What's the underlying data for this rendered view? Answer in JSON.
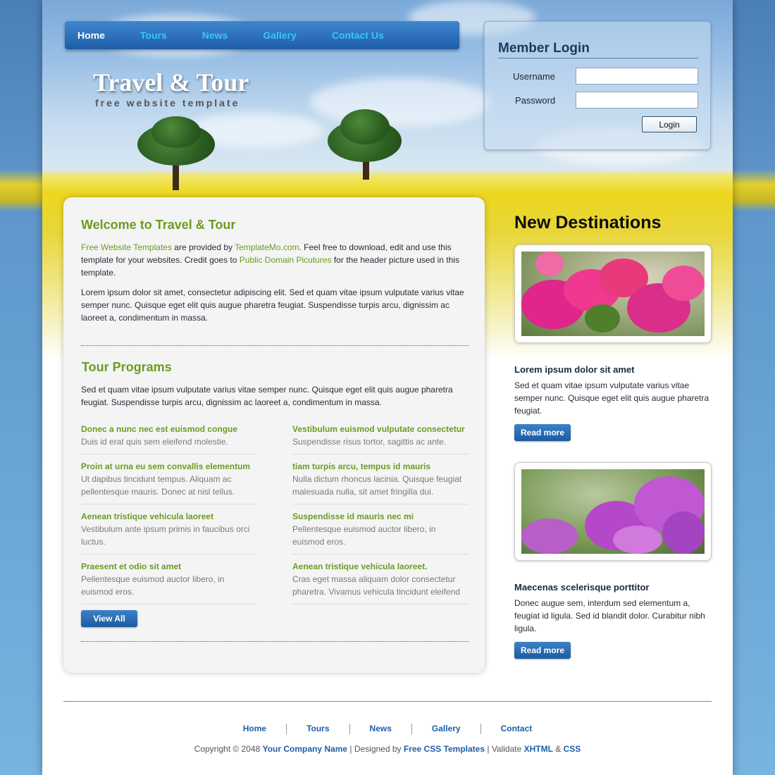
{
  "nav": {
    "items": [
      "Home",
      "Tours",
      "News",
      "Gallery",
      "Contact Us"
    ],
    "active": "Home"
  },
  "header": {
    "title": "Travel & Tour",
    "tagline": "free website template"
  },
  "login": {
    "title": "Member Login",
    "username_label": "Username",
    "password_label": "Password",
    "username_value": "",
    "password_value": "",
    "button": "Login"
  },
  "welcome": {
    "title": "Welcome to Travel & Tour",
    "p1_link1": "Free Website Templates",
    "p1_t1": " are provided by ",
    "p1_link2": "TemplateMo.com",
    "p1_t2": ". Feel free to download, edit and use this template for your websites. Credit goes to ",
    "p1_link3": "Public Domain Picutures",
    "p1_t3": " for the header picture used in this template.",
    "p2": "Lorem ipsum dolor sit amet, consectetur adipiscing elit. Sed et quam vitae ipsum vulputate varius vitae semper nunc. Quisque eget elit quis augue pharetra feugiat. Suspendisse turpis arcu, dignissim ac laoreet a, condimentum in massa."
  },
  "programs": {
    "title": "Tour Programs",
    "intro": "Sed et quam vitae ipsum vulputate varius vitae semper nunc. Quisque eget elit quis augue pharetra feugiat. Suspendisse turpis arcu, dignissim ac laoreet a, condimentum in massa.",
    "items": [
      {
        "title": "Donec a nunc nec est euismod congue",
        "desc": "Duis id erat quis sem eleifend molestie."
      },
      {
        "title": "Vestibulum euismod vulputate consectetur",
        "desc": "Suspendisse risus tortor, sagittis ac ante."
      },
      {
        "title": "Proin at urna eu sem convallis elementum",
        "desc": "Ut dapibus tincidunt tempus. Aliquam ac pellentesque mauris. Donec at nisl tellus."
      },
      {
        "title": "tiam turpis arcu, tempus id mauris",
        "desc": "Nulla dictum rhoncus lacinia. Quisque feugiat malesuada nulla, sit amet fringilla dui."
      },
      {
        "title": "Aenean tristique vehicula laoreet",
        "desc": "Vestibulum ante ipsum primis in faucibus orci luctus."
      },
      {
        "title": "Suspendisse id mauris nec mi",
        "desc": "Pellentesque euismod auctor libero, in euismod eros."
      },
      {
        "title": "Praesent et odio sit amet",
        "desc": "Pellentesque euismod auctor libero, in euismod eros."
      },
      {
        "title": "Aenean tristique vehicula laoreet.",
        "desc": "Cras eget massa aliquam dolor consectetur pharetra. Vivamus vehicula tincidunt eleifend"
      }
    ],
    "view_all": "View All"
  },
  "sidebar": {
    "title": "New Destinations",
    "destinations": [
      {
        "title": "Lorem ipsum dolor sit amet",
        "text": "Sed et quam vitae ipsum vulputate varius vitae semper nunc. Quisque eget elit quis augue pharetra feugiat.",
        "button": "Read more"
      },
      {
        "title": "Maecenas scelerisque porttitor",
        "text": "Donec augue sem, interdum sed elementum a, feugiat id ligula. Sed id blandit dolor. Curabitur nibh ligula.",
        "button": "Read more"
      }
    ]
  },
  "footer": {
    "nav": [
      "Home",
      "Tours",
      "News",
      "Gallery",
      "Contact"
    ],
    "copyright_prefix": "Copyright © 2048 ",
    "company": "Your Company Name",
    "designed_by": " | Designed by ",
    "designer": "Free CSS Templates",
    "validate": " | Validate ",
    "xhtml": "XHTML",
    "amp": " & ",
    "css": "CSS"
  },
  "colors": {
    "accent_green": "#6d9b22",
    "nav_link": "#37c6f4",
    "button_blue": "#1f5ea8"
  }
}
